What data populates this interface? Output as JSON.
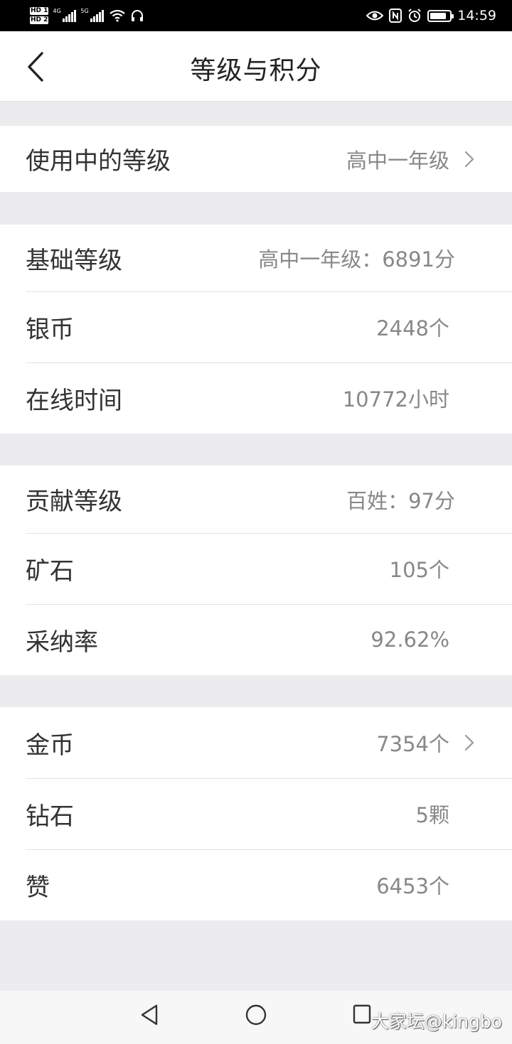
{
  "status_bar": {
    "hd1": "HD 1",
    "hd2": "HD 2",
    "net1": "4G",
    "net2": "5G",
    "time": "14:59",
    "battery_level": 0.85,
    "icons": [
      "wifi-icon",
      "headphones-icon",
      "eye-icon",
      "nfc-icon",
      "alarm-icon",
      "battery-icon"
    ]
  },
  "header": {
    "title": "等级与积分",
    "back_icon": "chevron-left-icon"
  },
  "current_level": {
    "label": "使用中的等级",
    "value": "高中一年级"
  },
  "basic_section": [
    {
      "label": "基础等级",
      "value": "高中一年级：6891分"
    },
    {
      "label": "银币",
      "value": "2448个"
    },
    {
      "label": "在线时间",
      "value": "10772小时"
    }
  ],
  "contribution_section": [
    {
      "label": "贡献等级",
      "value": "百姓：97分"
    },
    {
      "label": "矿石",
      "value": "105个"
    },
    {
      "label": "采纳率",
      "value": "92.62%"
    }
  ],
  "assets_section": [
    {
      "label": "金币",
      "value": "7354个"
    },
    {
      "label": "钻石",
      "value": "5颗"
    },
    {
      "label": "赞",
      "value": "6453个"
    }
  ],
  "nav_bar": {
    "icons": [
      "back-triangle-icon",
      "home-circle-icon",
      "recents-square-icon"
    ],
    "watermark": "大家坛@kingbo"
  }
}
